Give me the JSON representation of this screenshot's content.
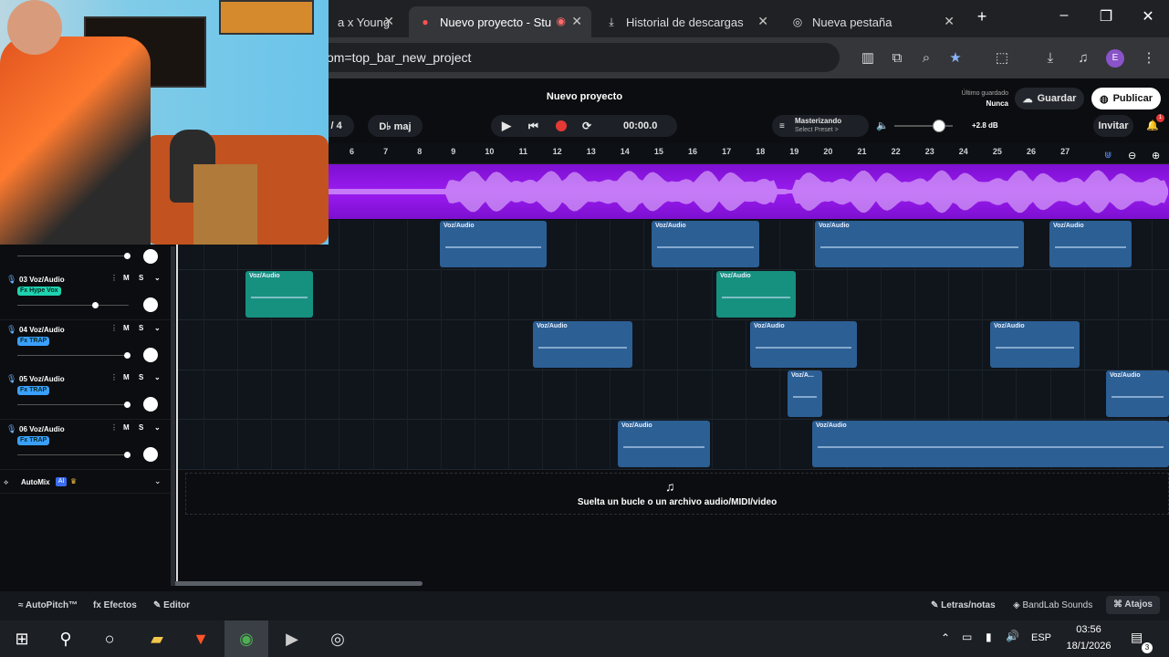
{
  "browser": {
    "tabs": [
      {
        "label": "a x Young",
        "active": false
      },
      {
        "label": "Nuevo proyecto - Stu",
        "active": true
      },
      {
        "label": "Historial de descargas",
        "active": false
      },
      {
        "label": "Nueva pestaña",
        "active": false
      }
    ],
    "url": "om=top_bar_new_project",
    "profile_initial": "E"
  },
  "app": {
    "project_title": "Nuevo proyecto",
    "saved_label": "Último guardado",
    "saved_value": "Nunca",
    "save_button": "Guardar",
    "publish_button": "Publicar",
    "invite_button": "Invitar",
    "notification_count": "1",
    "time_signature": "4 / 4",
    "key": "D♭ maj",
    "time_display": "00:00.0",
    "mastering_title": "Masterizando",
    "mastering_sub": "Select Preset >",
    "master_gain": "+2.8 dB",
    "ruler_numbers": [
      "6",
      "7",
      "8",
      "9",
      "10",
      "11",
      "12",
      "13",
      "14",
      "15",
      "16",
      "17",
      "18",
      "19",
      "20",
      "21",
      "22",
      "23",
      "24",
      "25",
      "26",
      "27"
    ]
  },
  "tracks": [
    {
      "name": "03 Voz/Audio",
      "fx": "Fx Hype Vox",
      "fx_color": "#1fd3b0"
    },
    {
      "name": "04 Voz/Audio",
      "fx": "Fx TRAP",
      "fx_color": "#3aa0ff"
    },
    {
      "name": "05 Voz/Audio",
      "fx": "Fx TRAP",
      "fx_color": "#3aa0ff"
    },
    {
      "name": "06 Voz/Audio",
      "fx": "Fx TRAP",
      "fx_color": "#3aa0ff"
    }
  ],
  "mute_label": "M",
  "solo_label": "S",
  "clip_label": "Voz/Audio",
  "clip_label_short": "Voz/A...",
  "automix": "AutoMix",
  "drop_hint": "Suelta un bucle o un archivo audio/MIDI/video",
  "bottom": {
    "autopitch": "AutoPitch™",
    "effects": "Efectos",
    "editor": "Editor",
    "lyrics": "Letras/notas",
    "sounds": "BandLab Sounds",
    "shortcuts": "Atajos"
  },
  "taskbar": {
    "lang": "ESP",
    "time": "03:56",
    "date": "18/1/2026",
    "notif": "3"
  },
  "colors": {
    "accent_purple": "#9a1cf0",
    "clip_blue": "#2c5f94",
    "clip_teal": "#16907f",
    "record_red": "#e53935"
  }
}
